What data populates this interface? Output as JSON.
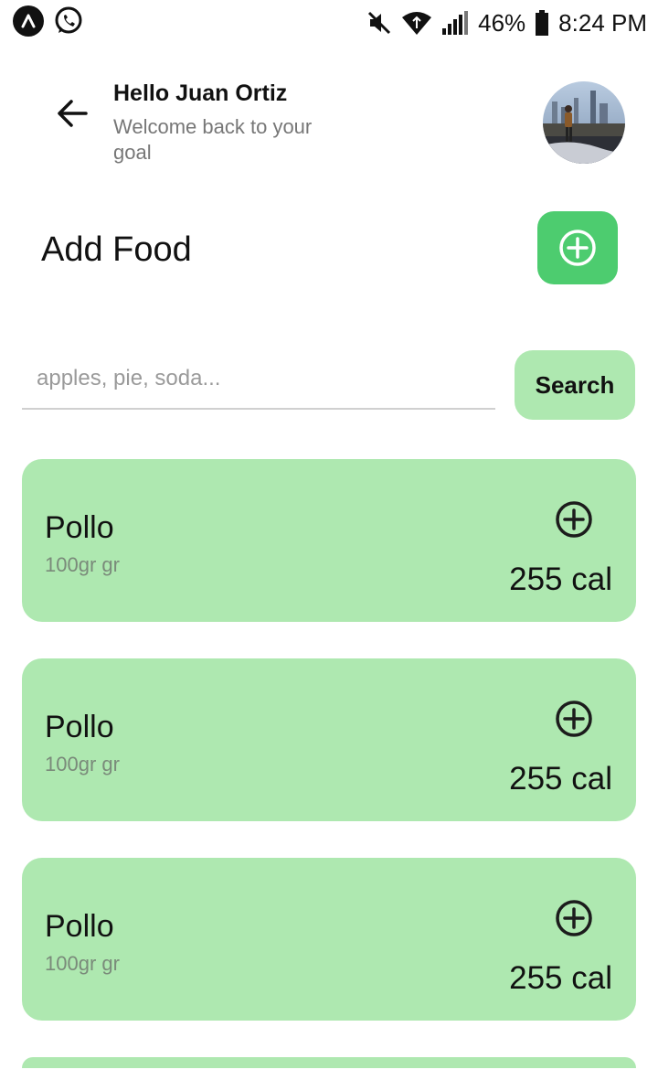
{
  "status_bar": {
    "battery": "46%",
    "time": "8:24 PM"
  },
  "header": {
    "title": "Hello Juan Ortiz",
    "subtitle": "Welcome back to your goal"
  },
  "page": {
    "title": "Add Food"
  },
  "search": {
    "placeholder": "apples, pie, soda...",
    "value": "",
    "button_label": "Search"
  },
  "foods": [
    {
      "name": "Pollo",
      "portion": "100gr gr",
      "calories": "255 cal"
    },
    {
      "name": "Pollo",
      "portion": "100gr gr",
      "calories": "255 cal"
    },
    {
      "name": "Pollo",
      "portion": "100gr gr",
      "calories": "255 cal"
    }
  ],
  "colors": {
    "accent": "#4dcc6f",
    "card": "#aee8b0"
  }
}
